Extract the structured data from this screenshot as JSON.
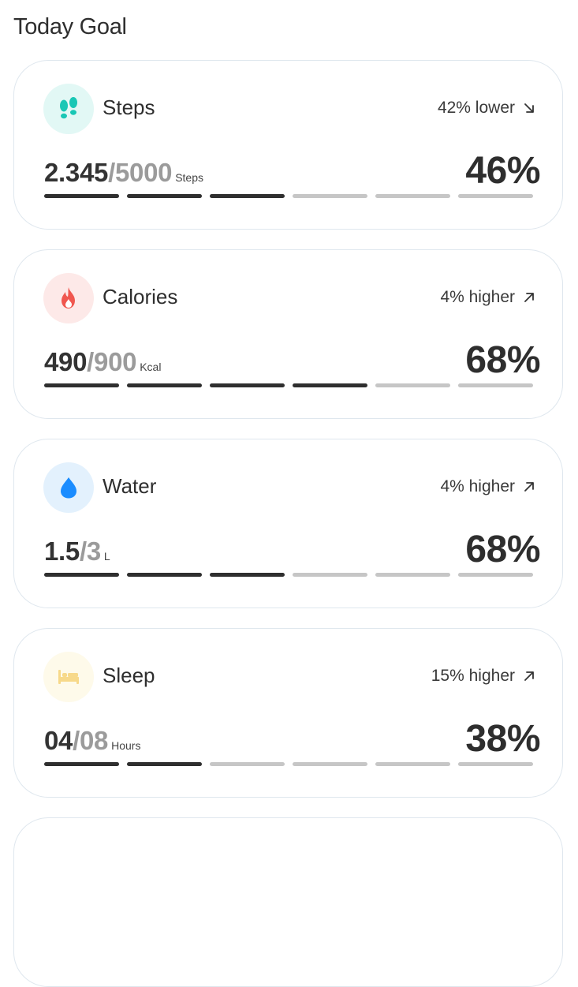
{
  "page": {
    "title": "Today Goal"
  },
  "cards": [
    {
      "name": "steps",
      "title": "Steps",
      "icon": "footprints-icon",
      "icon_color": "#19c7b5",
      "icon_bg": "#e2f8f5",
      "trend": {
        "text": "42% lower",
        "direction": "down-right"
      },
      "current": "2.345",
      "goal": "5000",
      "unit": "Steps",
      "percent": "46%",
      "segments_total": 6,
      "segments_filled": 3
    },
    {
      "name": "calories",
      "title": "Calories",
      "icon": "flame-icon",
      "icon_color": "#f0574f",
      "icon_bg": "#fde9e8",
      "trend": {
        "text": "4% higher",
        "direction": "up-right"
      },
      "current": "490",
      "goal": "900",
      "unit": "Kcal",
      "percent": "68%",
      "segments_total": 6,
      "segments_filled": 4
    },
    {
      "name": "water",
      "title": "Water",
      "icon": "water-drop-icon",
      "icon_color": "#1a8cff",
      "icon_bg": "#e3f1fd",
      "trend": {
        "text": "4% higher",
        "direction": "up-right"
      },
      "current": "1.5",
      "goal": "3",
      "unit": "L",
      "percent": "68%",
      "segments_total": 6,
      "segments_filled": 3
    },
    {
      "name": "sleep",
      "title": "Sleep",
      "icon": "bed-icon",
      "icon_color": "#f7d98a",
      "icon_bg": "#fefaea",
      "trend": {
        "text": "15% higher",
        "direction": "up-right"
      },
      "current": "04",
      "goal": "08",
      "unit": "Hours",
      "percent": "38%",
      "segments_total": 6,
      "segments_filled": 2
    }
  ],
  "colors": {
    "card_border": "#dfe7ee",
    "segment_filled": "#2f2f2f",
    "segment_empty": "#c6c6c6"
  }
}
